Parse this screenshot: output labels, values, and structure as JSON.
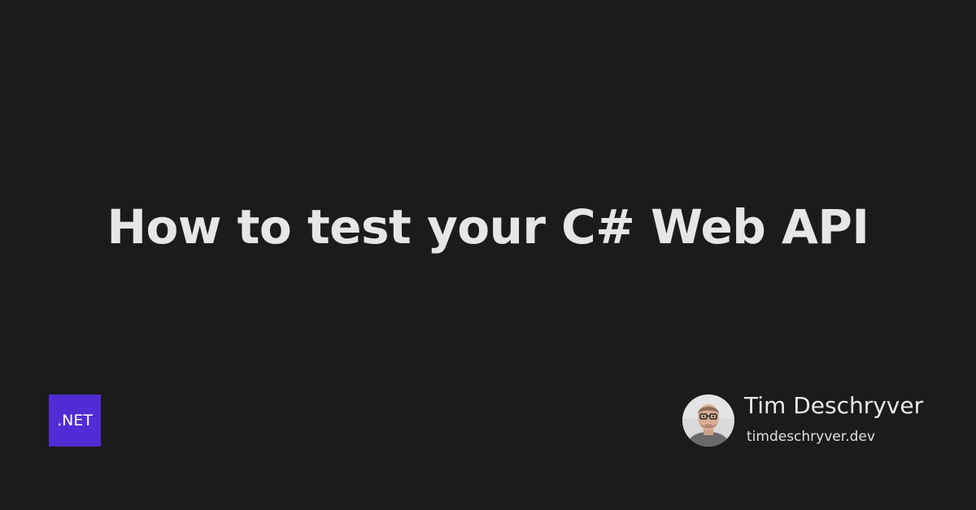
{
  "title": "How to test your C# Web API",
  "badge": {
    "label": ".NET",
    "color": "#512bd4"
  },
  "author": {
    "name": "Tim Deschryver",
    "website": "timdeschryver.dev",
    "avatar_icon": "author-avatar"
  },
  "colors": {
    "background": "#1b1b1b",
    "text": "#e6e6e6"
  }
}
